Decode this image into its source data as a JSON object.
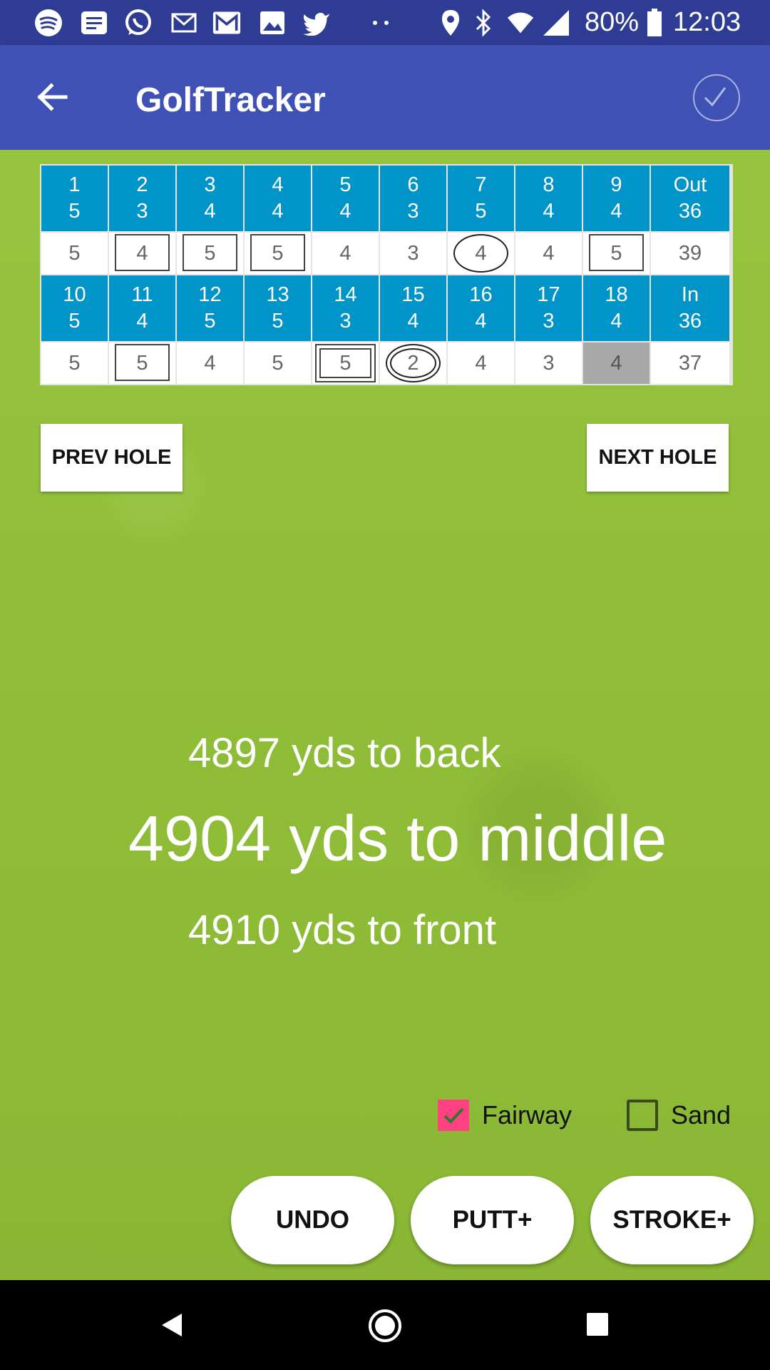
{
  "status_bar": {
    "icons": [
      "spotify-icon",
      "news-icon",
      "whatsapp-icon",
      "mail-icon",
      "gmail-icon",
      "photo-icon",
      "twitter-icon",
      "more-dots-icon",
      "location-icon",
      "bluetooth-icon",
      "wifi-icon",
      "signal-icon",
      "battery-icon"
    ],
    "battery": "80%",
    "time": "12:03"
  },
  "app_bar": {
    "title": "GolfTracker"
  },
  "front_nine": {
    "holes": [
      {
        "hole": "1",
        "par": "5",
        "score": "5",
        "mark": "none"
      },
      {
        "hole": "2",
        "par": "3",
        "score": "4",
        "mark": "square"
      },
      {
        "hole": "3",
        "par": "4",
        "score": "5",
        "mark": "square"
      },
      {
        "hole": "4",
        "par": "4",
        "score": "5",
        "mark": "square"
      },
      {
        "hole": "5",
        "par": "4",
        "score": "4",
        "mark": "none"
      },
      {
        "hole": "6",
        "par": "3",
        "score": "3",
        "mark": "none"
      },
      {
        "hole": "7",
        "par": "5",
        "score": "4",
        "mark": "circle"
      },
      {
        "hole": "8",
        "par": "4",
        "score": "4",
        "mark": "none"
      },
      {
        "hole": "9",
        "par": "4",
        "score": "5",
        "mark": "square"
      }
    ],
    "total_label": "Out",
    "total_par": "36",
    "total_score": "39"
  },
  "back_nine": {
    "holes": [
      {
        "hole": "10",
        "par": "5",
        "score": "5",
        "mark": "none"
      },
      {
        "hole": "11",
        "par": "4",
        "score": "5",
        "mark": "square"
      },
      {
        "hole": "12",
        "par": "5",
        "score": "4",
        "mark": "none"
      },
      {
        "hole": "13",
        "par": "5",
        "score": "5",
        "mark": "none"
      },
      {
        "hole": "14",
        "par": "3",
        "score": "5",
        "mark": "double-square"
      },
      {
        "hole": "15",
        "par": "4",
        "score": "2",
        "mark": "double-circle"
      },
      {
        "hole": "16",
        "par": "4",
        "score": "4",
        "mark": "none"
      },
      {
        "hole": "17",
        "par": "3",
        "score": "3",
        "mark": "none"
      },
      {
        "hole": "18",
        "par": "4",
        "score": "4",
        "mark": "current"
      }
    ],
    "total_label": "In",
    "total_par": "36",
    "total_score": "37"
  },
  "buttons": {
    "prev": "PREV HOLE",
    "next": "NEXT HOLE",
    "undo": "UNDO",
    "putt": "PUTT+",
    "stroke": "STROKE+"
  },
  "distances": {
    "back": "4897 yds to back",
    "middle": "4904 yds to middle",
    "front": "4910 yds to front"
  },
  "options": {
    "fairway_label": "Fairway",
    "fairway_checked": true,
    "sand_label": "Sand",
    "sand_checked": false
  },
  "colors": {
    "status_bar": "#2f3c93",
    "app_bar": "#3f51b5",
    "header_cell": "#0094c9",
    "checkbox_accent": "#ff4081"
  }
}
